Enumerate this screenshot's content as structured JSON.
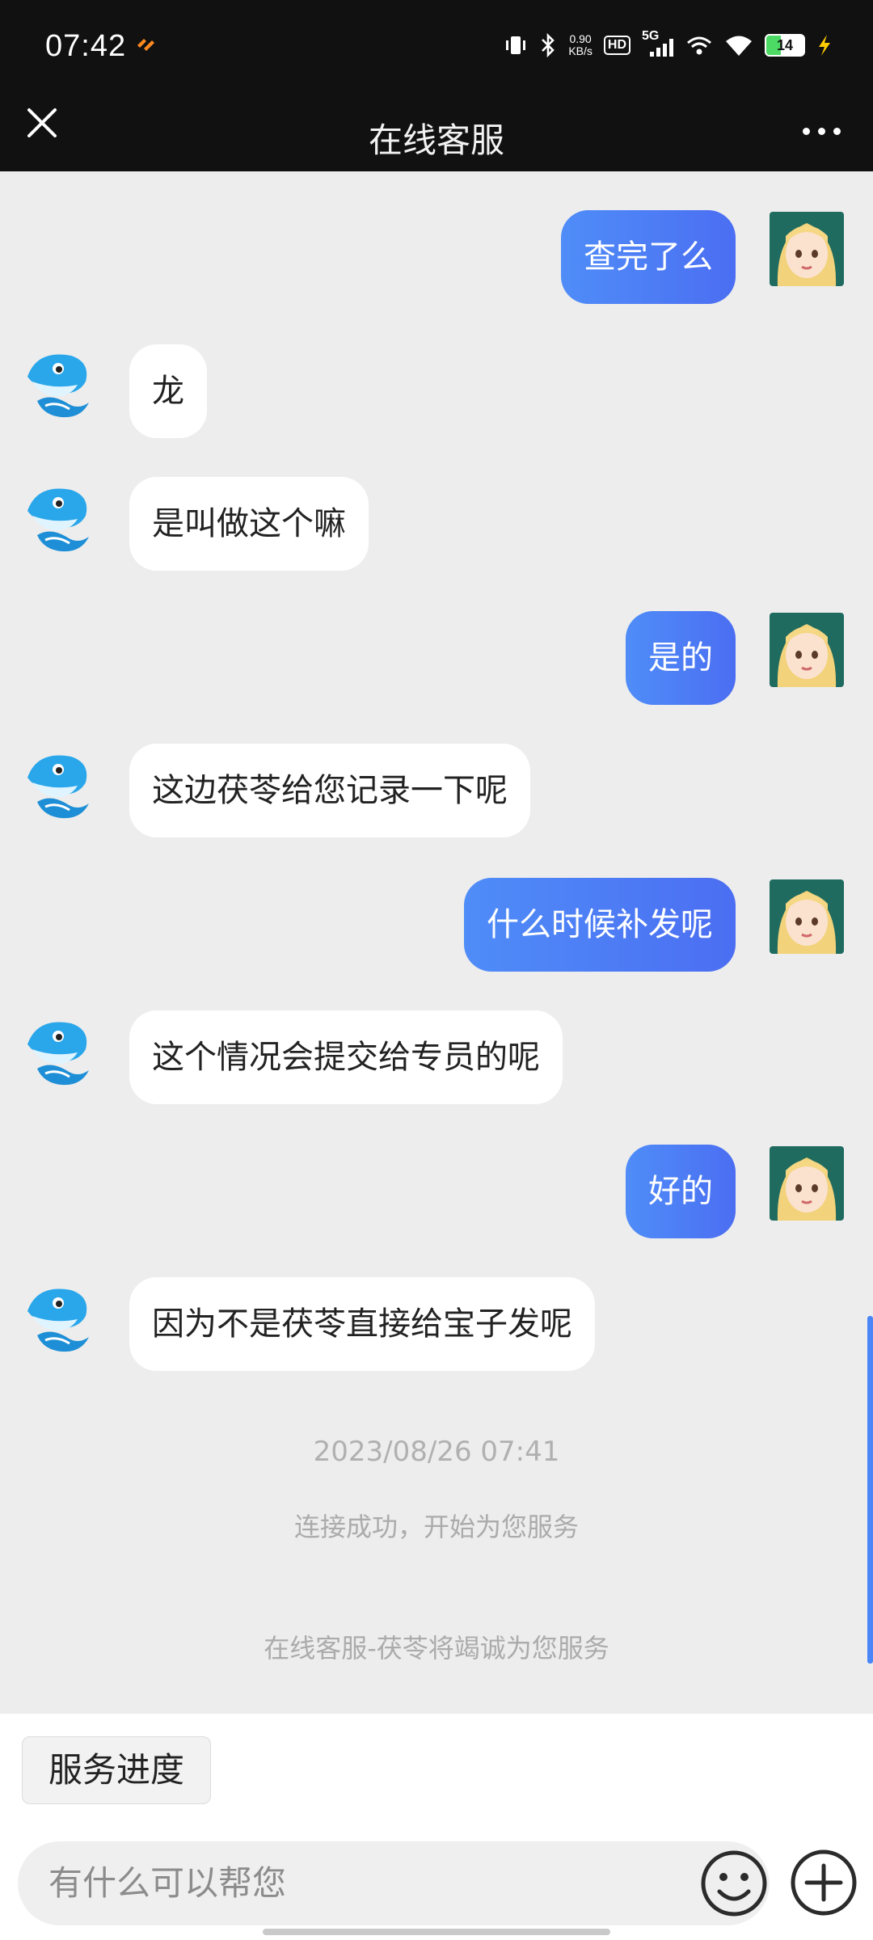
{
  "status_bar": {
    "time": "07:42",
    "net_speed_value": "0.90",
    "net_speed_unit": "KB/s",
    "hd_label": "HD",
    "network_type": "5G",
    "battery_level": "14"
  },
  "header": {
    "title": "在线客服"
  },
  "messages": [
    {
      "sender": "user",
      "text": "查完了么"
    },
    {
      "sender": "agent",
      "text": "龙"
    },
    {
      "sender": "agent",
      "text": "是叫做这个嘛"
    },
    {
      "sender": "user",
      "text": "是的"
    },
    {
      "sender": "agent",
      "text": "这边茯苓给您记录一下呢"
    },
    {
      "sender": "user",
      "text": "什么时候补发呢"
    },
    {
      "sender": "agent",
      "text": "这个情况会提交给专员的呢"
    },
    {
      "sender": "user",
      "text": "好的"
    },
    {
      "sender": "agent",
      "text": "因为不是茯苓直接给宝子发呢"
    }
  ],
  "system": {
    "timestamp": "2023/08/26 07:41",
    "connected_text": "连接成功，开始为您服务",
    "agent_intro": "在线客服-茯苓将竭诚为您服务"
  },
  "quick_actions": {
    "service_progress": "服务进度"
  },
  "input": {
    "placeholder": "有什么可以帮您"
  },
  "colors": {
    "user_bubble_start": "#4f8df8",
    "user_bubble_end": "#4b6ef2",
    "header_bg": "#111111",
    "chat_bg": "#ededed",
    "scroll_accent": "#4a86f7"
  }
}
